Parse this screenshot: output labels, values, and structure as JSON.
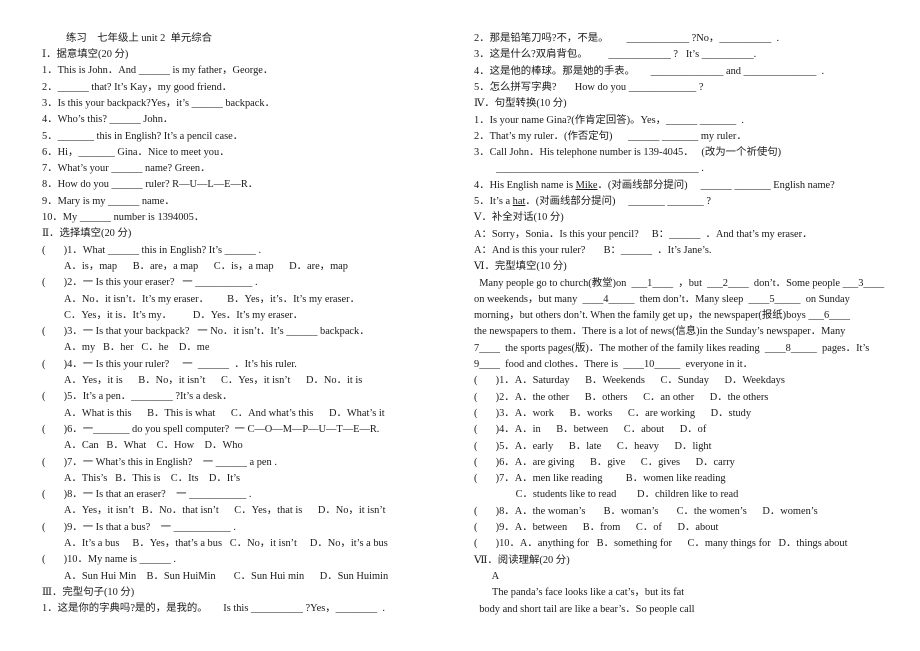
{
  "title": "练习　七年级上 unit 2  单元综合",
  "left": [
    {
      "text": "Ⅰ．据意填空(20 分)",
      "type": "heading"
    },
    {
      "text": "1．This is John．And ______ is my father，George．"
    },
    {
      "text": "2．______ that? It’s Kay，my good friend．"
    },
    {
      "text": "3．Is this your backpack?Yes，it’s ______ backpack．"
    },
    {
      "text": "4．Who’s this? ______ John．"
    },
    {
      "text": "5．_______ this in English? It’s a pencil case．"
    },
    {
      "text": "6．Hi，_______ Gina．Nice to meet you．"
    },
    {
      "text": "7．What’s your ______ name? Green．"
    },
    {
      "text": "8．How do you ______ ruler? R—U—L—E—R．"
    },
    {
      "text": "9．Mary is my ______ name．"
    },
    {
      "text": "10．My ______ number is 1394005．"
    },
    {
      "text": "Ⅱ．选择填空(20 分)",
      "type": "heading"
    },
    {
      "text": "(       )1．What ______ this in English? It’s ______ ."
    },
    {
      "text": "A．is，map      B．are，a map      C．is，a map      D．are，map",
      "type": "option"
    },
    {
      "text": "(       )2．一 Is this your eraser?   一 ___________ ."
    },
    {
      "text": "A．No．it isn’t．It’s my eraser．       B．Yes，it’s．It’s my eraser．",
      "type": "option"
    },
    {
      "text": "C．Yes，it is．It’s my．        D．Yes．It’s my eraser．",
      "type": "option"
    },
    {
      "text": "(       )3．一 Is that your backpack?   一 No．it isn’t．It’s ______ backpack．"
    },
    {
      "text": "A．my   B．her   C．he    D．me",
      "type": "option"
    },
    {
      "text": "(       )4．一 Is this your ruler?     一  ______  ．It’s his ruler."
    },
    {
      "text": "A．Yes，it is      B．No，it isn’t      C．Yes，it isn’t      D．No．it is",
      "type": "option"
    },
    {
      "text": "(       )5．It’s a pen．________ ?It’s a desk．"
    },
    {
      "text": "A．What is this      B．This is what      C．And what’s this      D．What’s it",
      "type": "option"
    },
    {
      "text": "(       )6．一_______ do you spell computer?  一 C—O—M—P—U—T—E—R."
    },
    {
      "text": "A．Can   B．What    C．How    D．Who",
      "type": "option"
    },
    {
      "text": "(       )7．一 What’s this in English?    一 ______ a pen ."
    },
    {
      "text": "A．This’s   B．This is    C．Its    D．It’s",
      "type": "option"
    },
    {
      "text": "(       )8．一 Is that an eraser?    一 ___________ ."
    },
    {
      "text": "A．Yes，it isn’t   B．No．that isn’t      C．Yes，that is      D．No，it isn’t",
      "type": "option"
    },
    {
      "text": "(       )9．一 Is that a bus?    一 ___________ ."
    },
    {
      "text": "A．It’s a bus     B．Yes，that’s a bus   C．No，it isn’t     D．No，it’s a bus",
      "type": "option"
    },
    {
      "text": "(       )10．My name is ______ ."
    },
    {
      "text": "A．Sun Hui Min    B．Sun HuiMin       C．Sun Hui min      D．Sun Huimin",
      "type": "option"
    },
    {
      "text": "Ⅲ．完型句子(10 分)",
      "type": "heading"
    },
    {
      "text": "1．这是你的字典吗?是的，是我的。      Is this __________ ?Yes，________  ."
    }
  ],
  "right": [
    {
      "text": "2．那是铅笔刀吗?不，不是。       ____________ ?No，__________  ."
    },
    {
      "text": "3．这是什么?双肩背包。        ____________ ?   It’s __________."
    },
    {
      "text": "4．这是他的棒球。那是她的手表。      ______________ and ______________  ."
    },
    {
      "text": "5．怎么拼写字典?       How do you _____________ ?"
    },
    {
      "text": "Ⅳ．句型转换(10 分)",
      "type": "heading"
    },
    {
      "text": "1．Is your name Gina?(作肯定回答)。Yes，______ _______  ."
    },
    {
      "text": "2．That’s my ruler．(作否定句)      ______ _______ my ruler．"
    },
    {
      "text": "3．Call John．His telephone number is 139-4045．   (改为一个祈使句)"
    },
    {
      "text": "_______________________________________ .",
      "type": "option"
    },
    {
      "text": "4．His English name is ",
      "u": "Mike",
      "after": "．(对画线部分提问)     ______ _______ English name?"
    },
    {
      "text": "5．It’s a ",
      "u": "hat",
      "after": "．(对画线部分提问)     _______ _______ ?"
    },
    {
      "text": "Ⅴ．补全对话(10 分)",
      "type": "heading"
    },
    {
      "text": "A：Sorry，Sonia．Is this your pencil?     B：______  ．And that’s my eraser．"
    },
    {
      "text": "A：And is this your ruler?       B：______  ．It’s Jane’s."
    },
    {
      "text": "Ⅵ．完型填空(10 分)",
      "type": "heading"
    },
    {
      "text": "  Many people go to church(教堂)on  ___1____  ，but  ___2____  don’t．Some people ___3____"
    },
    {
      "text": "on weekends，but many  ____4_____  them don’t．Many sleep  ____5_____  on Sunday"
    },
    {
      "text": "morning，but others don’t. When the family get up，the newspaper(报纸)boys ___6____"
    },
    {
      "text": "the newspapers to them．There is a lot of news(信息)in the Sunday’s newspaper．Many"
    },
    {
      "text": "7____  the sports pages(版)．The mother of the family likes reading  ____8_____  pages．It’s"
    },
    {
      "text": "9____  food and clothes．There is  ____10_____  everyone in it．"
    },
    {
      "text": "(       )1．A．Saturday      B．Weekends      C．Sunday      D．Weekdays"
    },
    {
      "text": "(       )2．A．the other      B．others      C．an other      D．the others"
    },
    {
      "text": "(       )3．A．work      B．works      C．are working      D．study"
    },
    {
      "text": "(       )4．A．in      B．between      C．about      D．of"
    },
    {
      "text": "(       )5．A．early      B．late      C．heavy      D．light"
    },
    {
      "text": "(       )6．A．are giving      B．give      C．gives      D．carry"
    },
    {
      "text": "(       )7．A．men like reading         B．women like reading"
    },
    {
      "text": "                C．students like to read        D．children like to read"
    },
    {
      "text": "(       )8．A．the woman’s       B．woman’s       C．the women’s      D．women’s"
    },
    {
      "text": "(       )9．A．between      B．from      C．of      D．about"
    },
    {
      "text": "(       )10．A．anything for   B．something for      C．many things for   D．things about"
    },
    {
      "text": "Ⅶ．阅读理解(20 分)",
      "type": "heading"
    },
    {
      "text": "       A"
    },
    {
      "text": "       The panda’s face looks like a cat’s，but its fat"
    },
    {
      "text": "  body and short tail are like a bear’s．So people call"
    }
  ]
}
